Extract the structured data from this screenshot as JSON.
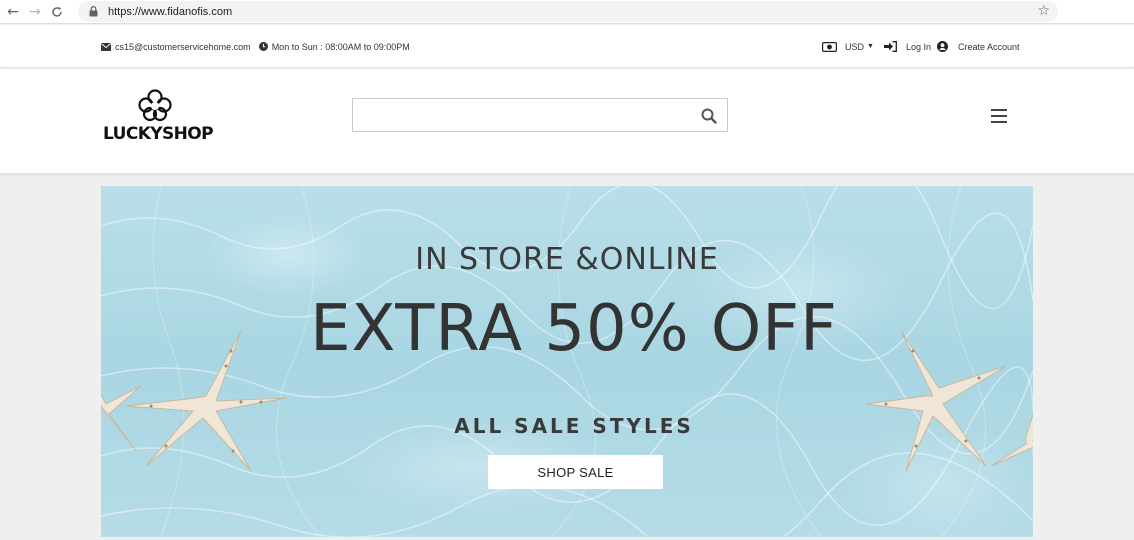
{
  "browser": {
    "url": "https://www.fidanofis.com",
    "back_icon": "arrow-left-icon",
    "forward_icon": "arrow-right-icon",
    "reload_icon": "reload-icon",
    "bookmark_icon": "star-icon"
  },
  "topbar": {
    "email": "cs15@customerservicehome.com",
    "hours": "Mon to Sun : 08:00AM to 09:00PM",
    "currency": "USD",
    "login": "Log In",
    "create_account": "Create Account"
  },
  "header": {
    "logo_text": "LUCKYSHOP",
    "search_placeholder": "",
    "search_value": ""
  },
  "banner": {
    "line1": "IN STORE &ONLINE",
    "line2": "EXTRA 50% OFF",
    "line3": "ALL SALE STYLES",
    "cta": "SHOP SALE"
  },
  "colors": {
    "banner_water": "#b5dce7",
    "text_dark": "#333333",
    "button_bg": "#ffffff"
  }
}
